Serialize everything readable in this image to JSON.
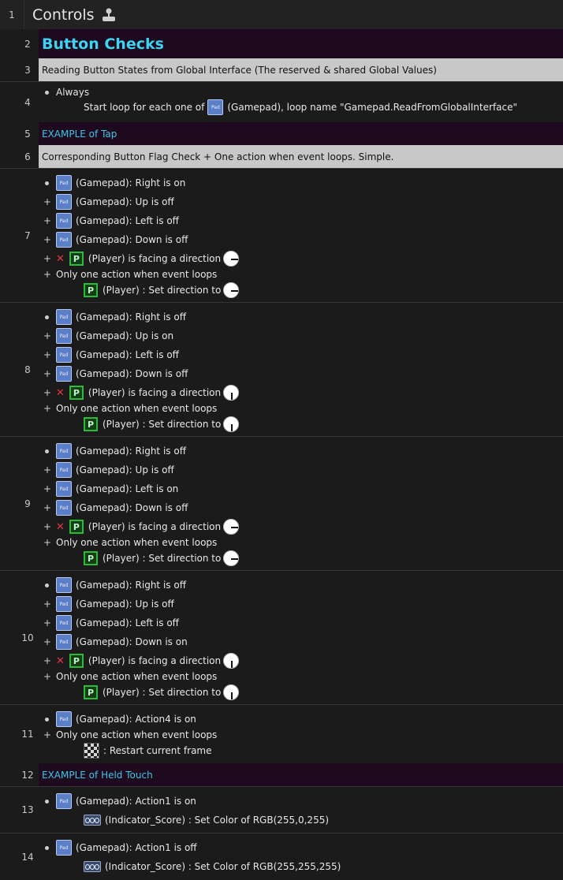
{
  "title_row": {
    "number": "1",
    "title": "Controls"
  },
  "rows": {
    "r2": {
      "number": "2",
      "text": "Button Checks"
    },
    "r3": {
      "number": "3",
      "text": "Reading Button States from Global Interface (The reserved & shared Global Values)"
    },
    "r4": {
      "number": "4",
      "condition": "Always",
      "action_pre": "Start loop for each one of",
      "action_post": "(Gamepad), loop name \"Gamepad.ReadFromGlobalInterface\""
    },
    "r5": {
      "number": "5",
      "text": "EXAMPLE of Tap"
    },
    "r6": {
      "number": "6",
      "text": "Corresponding Button Flag Check + One action when event loops. Simple."
    },
    "r7": {
      "number": "7",
      "c1": "(Gamepad): Right is on",
      "c2": "(Gamepad): Up is off",
      "c3": "(Gamepad): Left is off",
      "c4": "(Gamepad): Down is off",
      "c5": "(Player) is facing a direction",
      "c6": "Only one action when event loops",
      "a1": "(Player) : Set direction to"
    },
    "r8": {
      "number": "8",
      "c1": "(Gamepad): Right is off",
      "c2": "(Gamepad): Up is on",
      "c3": "(Gamepad): Left is off",
      "c4": "(Gamepad): Down is off",
      "c5": "(Player) is facing a direction",
      "c6": "Only one action when event loops",
      "a1": "(Player) : Set direction to"
    },
    "r9": {
      "number": "9",
      "c1": "(Gamepad): Right is off",
      "c2": "(Gamepad): Up is off",
      "c3": "(Gamepad): Left is on",
      "c4": "(Gamepad): Down is off",
      "c5": "(Player) is facing a direction",
      "c6": "Only one action when event loops",
      "a1": "(Player) : Set direction to"
    },
    "r10": {
      "number": "10",
      "c1": "(Gamepad): Right is off",
      "c2": "(Gamepad): Up is off",
      "c3": "(Gamepad): Left is off",
      "c4": "(Gamepad): Down is on",
      "c5": "(Player) is facing a direction",
      "c6": "Only one action when event loops",
      "a1": "(Player) : Set direction to"
    },
    "r11": {
      "number": "11",
      "c1": "(Gamepad): Action4 is on",
      "c2": "Only one action when event loops",
      "a1": ": Restart current frame"
    },
    "r12": {
      "number": "12",
      "text": "EXAMPLE of Held Touch"
    },
    "r13": {
      "number": "13",
      "c1": "(Gamepad): Action1 is on",
      "a1": "(Indicator_Score) : Set Color of RGB(255,0,255)"
    },
    "r14": {
      "number": "14",
      "c1": "(Gamepad): Action1 is off",
      "a1": "(Indicator_Score) : Set Color of RGB(255,255,255)"
    }
  },
  "icons": {
    "pad": "Pad",
    "player": "P"
  },
  "colors": {
    "title_cyan": "#3fd3f2",
    "group_bg": "#1e0a1e",
    "comment_bg": "#c8c8c8",
    "background": "#1b1b1b"
  }
}
